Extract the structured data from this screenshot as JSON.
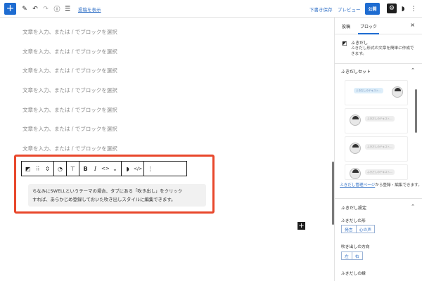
{
  "topbar": {
    "add_icon": "+",
    "pen_icon": "✎",
    "undo_icon": "↶",
    "redo_icon": "↷",
    "info_icon": "ⓘ",
    "list_icon": "☰",
    "show_post_link": "投稿を表示",
    "save_draft": "下書き保存",
    "preview": "プレビュー",
    "publish": "公開",
    "settings_icon": "⚙",
    "plugin_icon": "◗",
    "more_icon": "⋮"
  },
  "editor": {
    "placeholders": [
      "文章を入力、または / でブロックを選択",
      "文章を入力、または / でブロックを選択",
      "文章を入力、または / でブロックを選択",
      "文章を入力、または / でブロックを選択",
      "文章を入力、または / でブロックを選択",
      "文章を入力、または / でブロックを選択",
      "文章を入力、または / でブロックを選択"
    ],
    "balloon_text_line1": "ちなみにSWELLというテーマの場合、タブにある「吹き出し」をクリック",
    "balloon_text_line2": "すれば、あらかじめ登録しておいた吹き出しスタイルに編集できます。",
    "inserter_icon": "+",
    "toolbar": {
      "block_icon": "◩",
      "drag_icon": "⠿",
      "move_icon": "⇕",
      "style_icon": "◔",
      "paint_icon": "⊤",
      "bold": "B",
      "italic": "I",
      "link_icon": "<>",
      "dropdown_icon": "⌄",
      "swell_icon": "◗",
      "code_icon": "</>",
      "options_icon": "⋮"
    }
  },
  "sidebar": {
    "tab_post": "投稿",
    "tab_block": "ブロック",
    "close_icon": "×",
    "block_icon": "◩",
    "block_title": "ふきだし",
    "block_desc": "ふきだし形式の文章を簡単に作成できます。",
    "preset_panel_title": "ふきだしセット",
    "bubble_sample_text": "ふきだしのテキスト...",
    "mgmt_link": "ふきだし管理ページ",
    "mgmt_rest": "から登録・編集できます。",
    "settings_panel_title": "ふきだし設定",
    "shape_label": "ふきだしの形",
    "shape_options": [
      "発言",
      "心の声"
    ],
    "direction_label": "吹き出しの方向",
    "direction_options": [
      "左",
      "右"
    ],
    "line_label": "ふきだしの線",
    "chevron_up_icon": "⌃"
  },
  "colors": {
    "accent": "#1e6cd1",
    "highlight": "#e8472b"
  }
}
